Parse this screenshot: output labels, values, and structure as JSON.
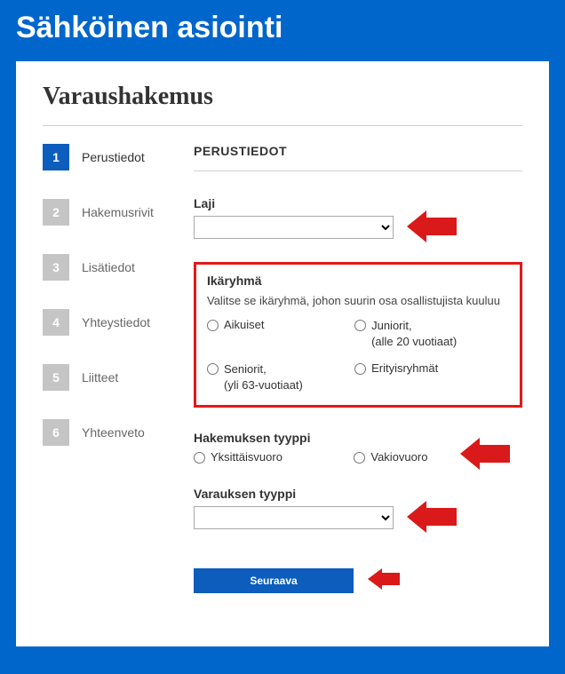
{
  "page": {
    "title": "Sähköinen asiointi"
  },
  "form": {
    "title": "Varaushakemus",
    "section_heading": "PERUSTIEDOT"
  },
  "steps": [
    {
      "num": "1",
      "label": "Perustiedot",
      "active": true
    },
    {
      "num": "2",
      "label": "Hakemusrivit",
      "active": false
    },
    {
      "num": "3",
      "label": "Lisätiedot",
      "active": false
    },
    {
      "num": "4",
      "label": "Yhteystiedot",
      "active": false
    },
    {
      "num": "5",
      "label": "Liitteet",
      "active": false
    },
    {
      "num": "6",
      "label": "Yhteenveto",
      "active": false
    }
  ],
  "fields": {
    "laji": {
      "label": "Laji",
      "value": ""
    },
    "ikaryhma": {
      "label": "Ikäryhmä",
      "help": "Valitse se ikäryhmä, johon suurin osa osallistujista kuuluu",
      "options": {
        "aikuiset": "Aikuiset",
        "juniorit_label": "Juniorit,",
        "juniorit_sub": "(alle 20 vuotiaat)",
        "seniorit_label": "Seniorit,",
        "seniorit_sub": "(yli 63-vuotiaat)",
        "erityis": "Erityisryhmät"
      }
    },
    "hakemuksen_tyyppi": {
      "label": "Hakemuksen tyyppi",
      "options": {
        "yksittais": "Yksittäisvuoro",
        "vakio": "Vakiovuoro"
      }
    },
    "varauksen_tyyppi": {
      "label": "Varauksen tyyppi",
      "value": ""
    }
  },
  "buttons": {
    "next": "Seuraava"
  }
}
